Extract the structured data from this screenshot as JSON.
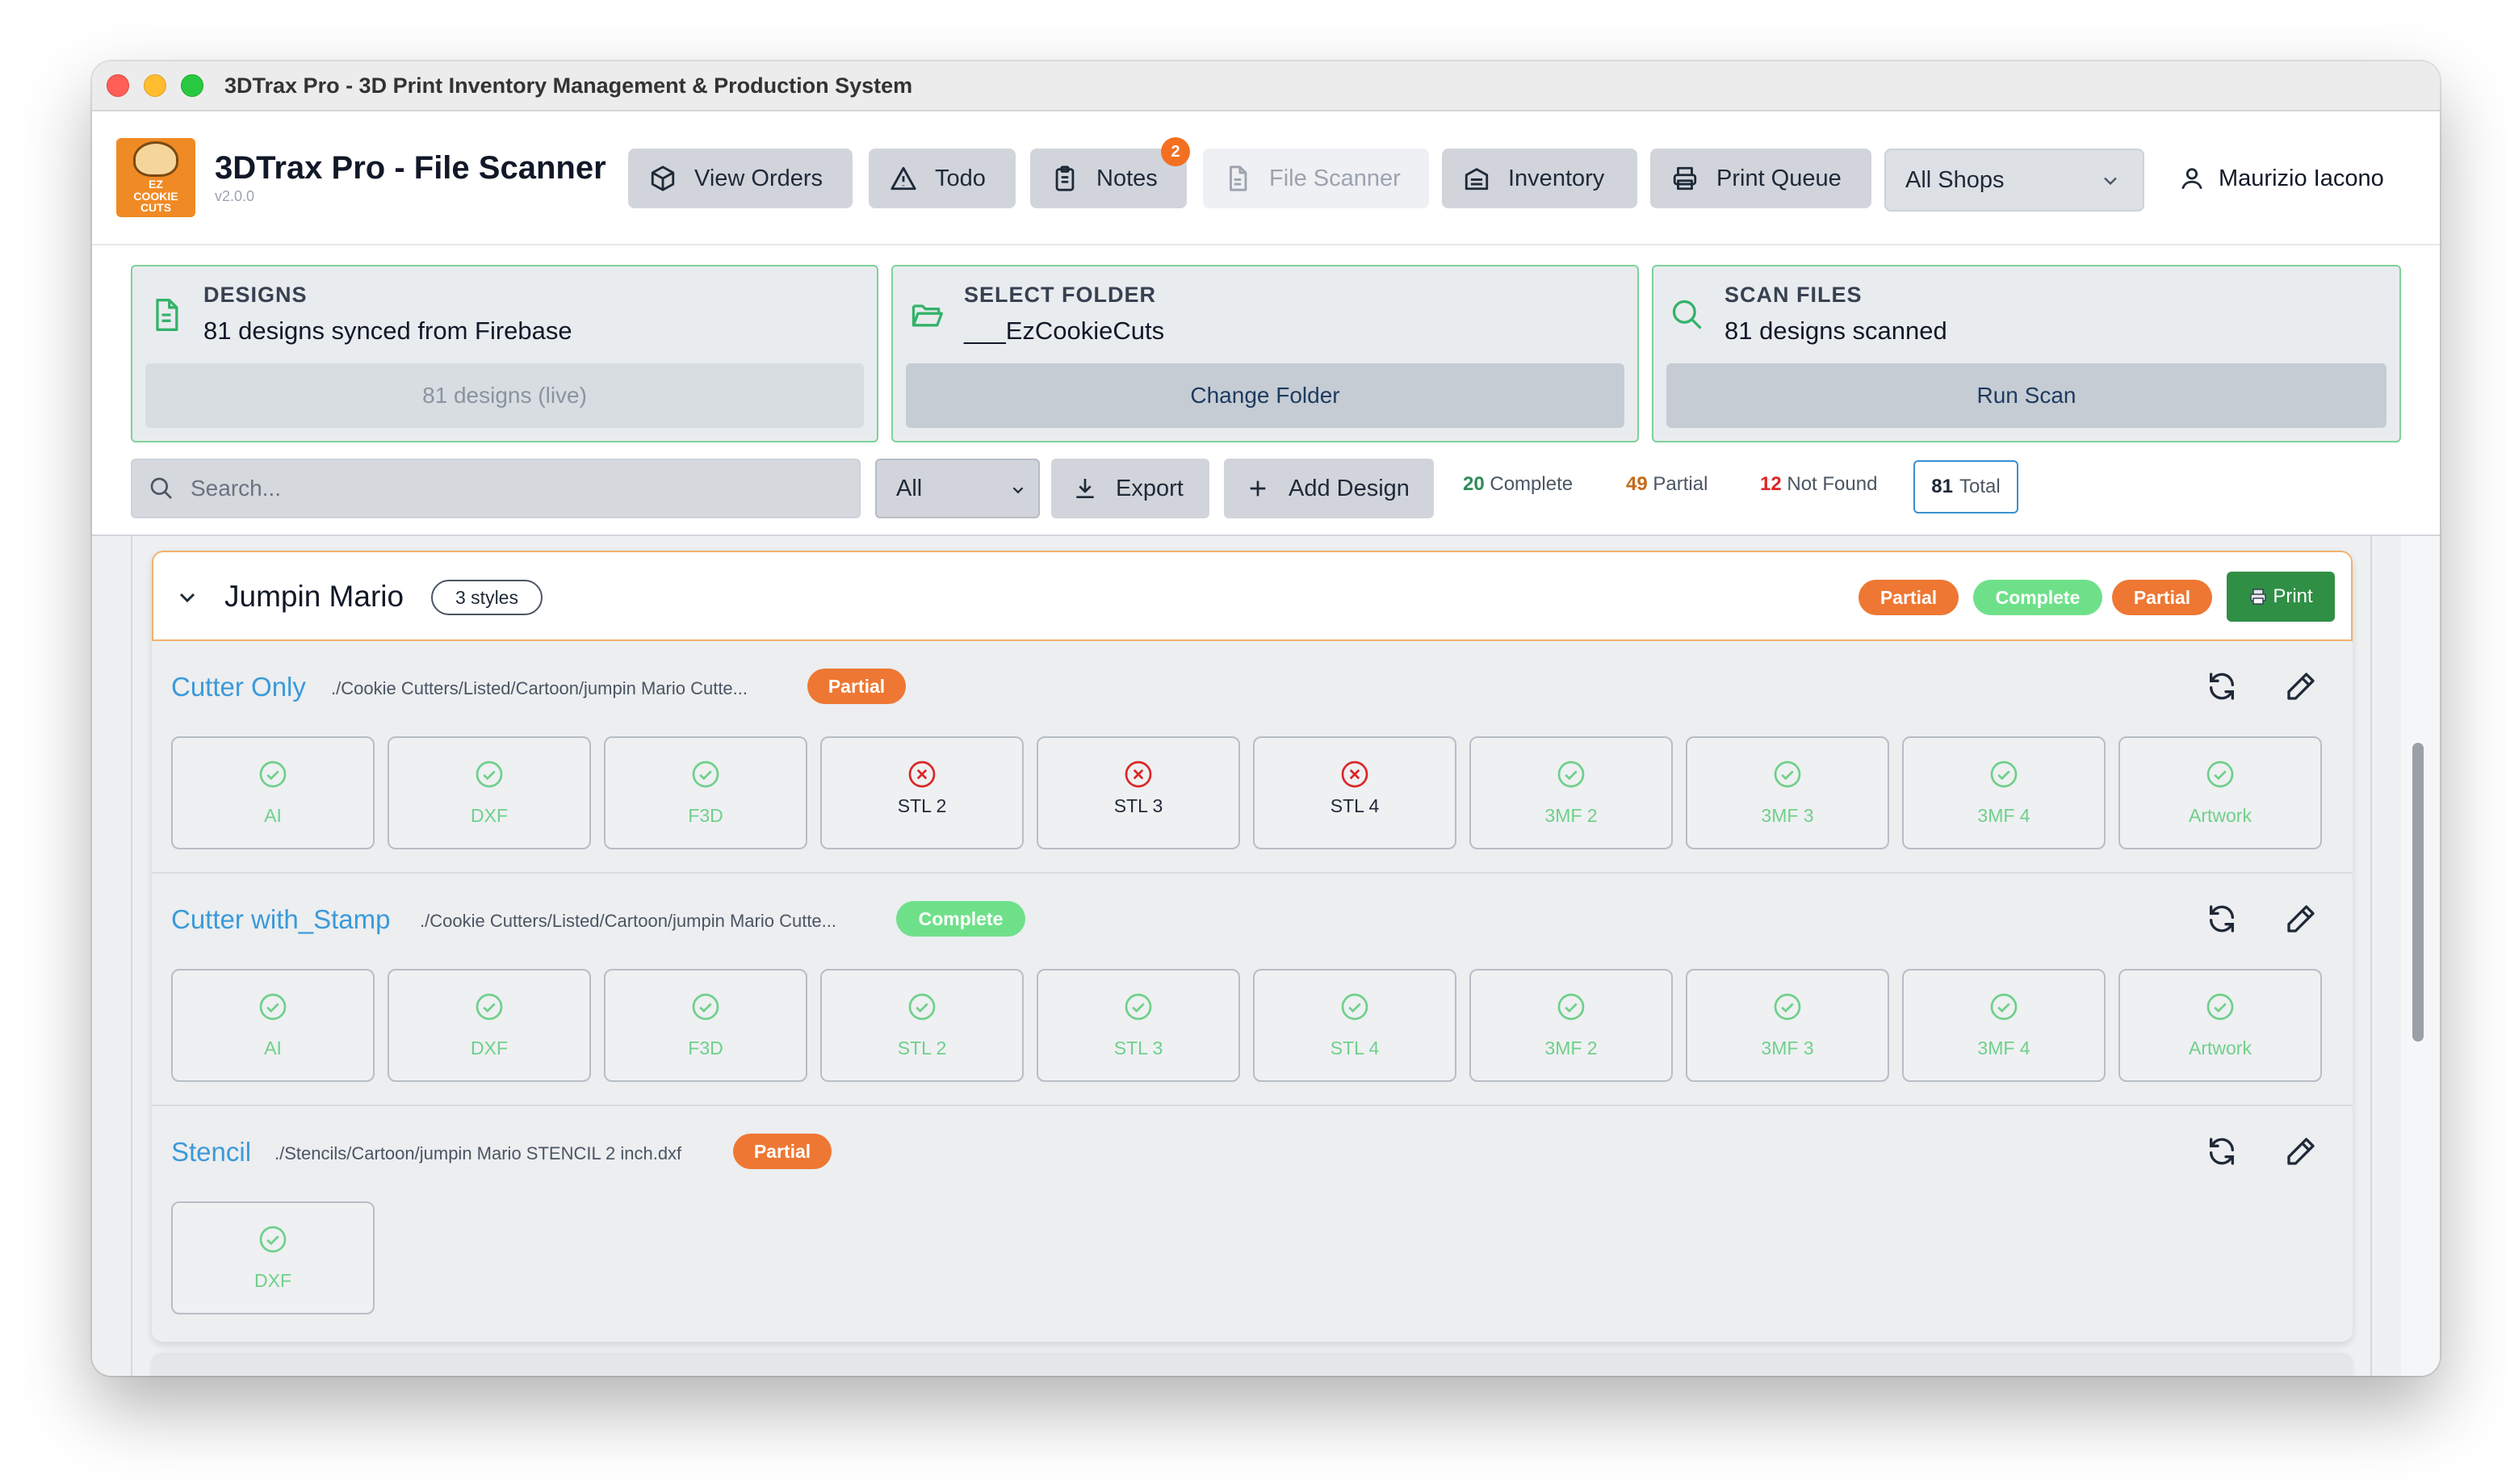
{
  "window": {
    "title": "3DTrax Pro - 3D Print Inventory Management & Production System"
  },
  "app": {
    "name": "3DTrax Pro - File Scanner",
    "version": "v2.0.0",
    "logo_text": [
      "EZ",
      "COOKIE",
      "CUTS"
    ]
  },
  "nav": {
    "view_orders": "View Orders",
    "todo": "Todo",
    "notes": "Notes",
    "notes_badge": "2",
    "file_scanner": "File Scanner",
    "inventory": "Inventory",
    "print_queue": "Print Queue",
    "shop_select": "All Shops",
    "user": "Maurizio Iacono"
  },
  "cards": {
    "designs": {
      "label": "DESIGNS",
      "value": "81 designs synced from Firebase",
      "button": "81 designs (live)"
    },
    "folder": {
      "label": "SELECT FOLDER",
      "value": "___EzCookieCuts",
      "button": "Change Folder"
    },
    "scan": {
      "label": "SCAN FILES",
      "value": "81 designs scanned",
      "button": "Run Scan"
    }
  },
  "toolbar": {
    "search_placeholder": "Search...",
    "filter_value": "All",
    "export": "Export",
    "add_design": "Add Design"
  },
  "stats": {
    "complete_count": "20",
    "complete_label": "Complete",
    "partial_count": "49",
    "partial_label": "Partial",
    "notfound_count": "12",
    "notfound_label": "Not Found",
    "total_count": "81",
    "total_label": "Total"
  },
  "colors": {
    "partial": "#ee7733",
    "complete": "#6fe08a",
    "missing": "#dc2626",
    "link": "#3b9ad9",
    "print": "#2f8f45"
  },
  "group": {
    "title": "Jumpin Mario",
    "styles_badge": "3 styles",
    "status_pills": [
      "Partial",
      "Complete",
      "Partial"
    ],
    "print_button": "Print",
    "styles": [
      {
        "name": "Cutter Only",
        "path": "./Cookie Cutters/Listed/Cartoon/jumpin Mario Cutte...",
        "status": "Partial",
        "files": [
          {
            "label": "AI",
            "ok": true
          },
          {
            "label": "DXF",
            "ok": true
          },
          {
            "label": "F3D",
            "ok": true
          },
          {
            "label": "STL 2",
            "ok": false
          },
          {
            "label": "STL 3",
            "ok": false
          },
          {
            "label": "STL 4",
            "ok": false
          },
          {
            "label": "3MF 2",
            "ok": true
          },
          {
            "label": "3MF 3",
            "ok": true
          },
          {
            "label": "3MF 4",
            "ok": true
          },
          {
            "label": "Artwork",
            "ok": true
          }
        ]
      },
      {
        "name": "Cutter with_Stamp",
        "path": "./Cookie Cutters/Listed/Cartoon/jumpin Mario Cutte...",
        "status": "Complete",
        "files": [
          {
            "label": "AI",
            "ok": true
          },
          {
            "label": "DXF",
            "ok": true
          },
          {
            "label": "F3D",
            "ok": true
          },
          {
            "label": "STL 2",
            "ok": true
          },
          {
            "label": "STL 3",
            "ok": true
          },
          {
            "label": "STL 4",
            "ok": true
          },
          {
            "label": "3MF 2",
            "ok": true
          },
          {
            "label": "3MF 3",
            "ok": true
          },
          {
            "label": "3MF 4",
            "ok": true
          },
          {
            "label": "Artwork",
            "ok": true
          }
        ]
      },
      {
        "name": "Stencil",
        "path": "./Stencils/Cartoon/jumpin Mario STENCIL 2 inch.dxf",
        "status": "Partial",
        "files": [
          {
            "label": "DXF",
            "ok": true
          }
        ]
      }
    ]
  }
}
